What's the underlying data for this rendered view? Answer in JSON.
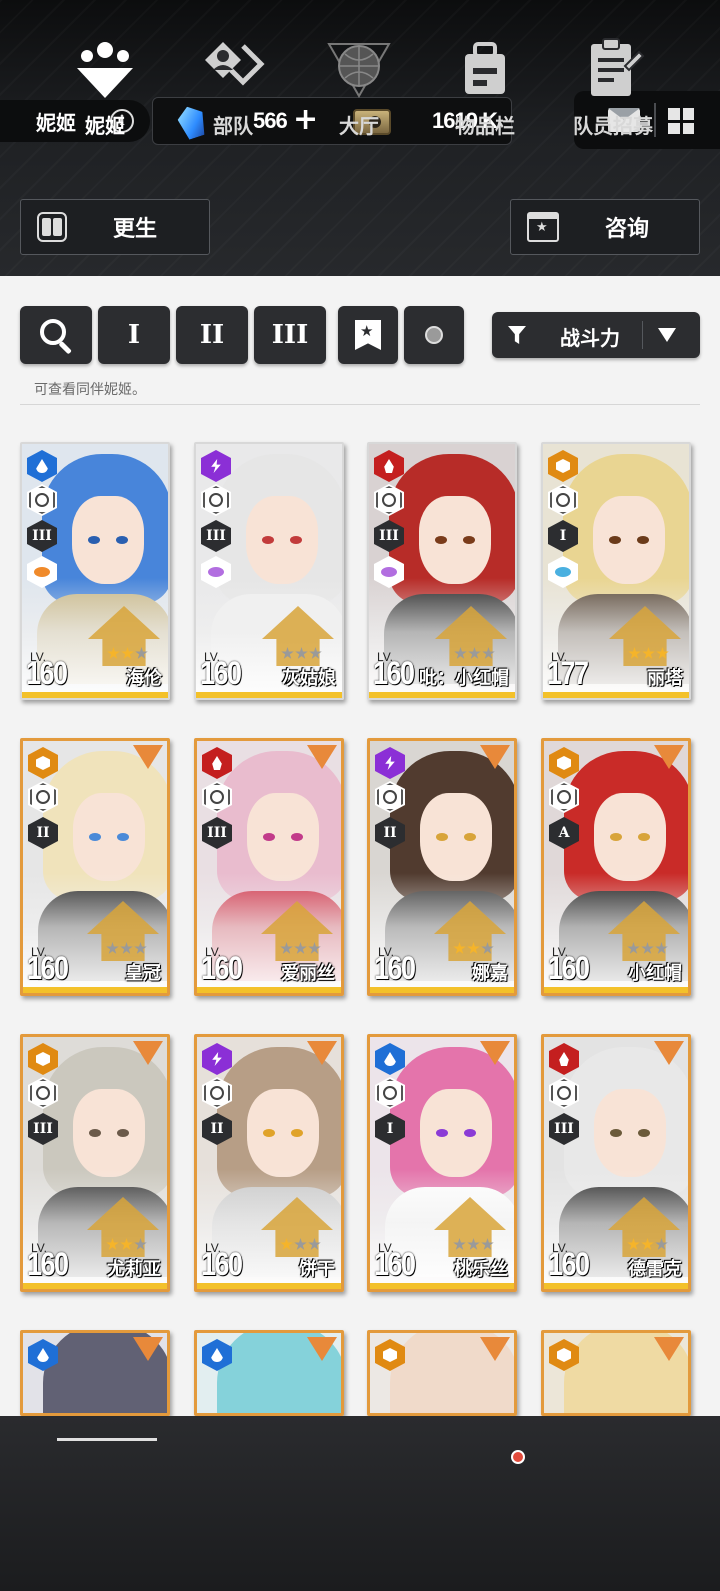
{
  "header": {
    "nikke_label": "妮姬",
    "gems": "566",
    "gem_plus": "+",
    "credits": "1619 K",
    "rebirth_label": "更生",
    "consult_label": "咨询"
  },
  "filters": {
    "burst_1": "I",
    "burst_2": "II",
    "burst_3": "III",
    "sort_label": "战斗力",
    "hint": "可查看同伴妮姬。"
  },
  "cards": [
    {
      "name": "海伦",
      "level": "160",
      "element": "water",
      "burst": "III",
      "stars": 2
    },
    {
      "name": "灰姑娘",
      "level": "160",
      "element": "electric",
      "burst": "III",
      "stars": 0
    },
    {
      "name": "吡：小红帽",
      "level": "160",
      "element": "fire",
      "burst": "III",
      "stars": 0
    },
    {
      "name": "丽塔",
      "level": "177",
      "element": "iron",
      "burst": "I",
      "stars": 3
    },
    {
      "name": "皇冠",
      "level": "160",
      "element": "iron",
      "burst": "II",
      "stars": 0
    },
    {
      "name": "爱丽丝",
      "level": "160",
      "element": "fire",
      "burst": "III",
      "stars": 0
    },
    {
      "name": "娜嘉",
      "level": "160",
      "element": "electric",
      "burst": "II",
      "stars": 2
    },
    {
      "name": "小红帽",
      "level": "160",
      "element": "iron",
      "burst": "A",
      "stars": 0
    },
    {
      "name": "尤莉亚",
      "level": "160",
      "element": "iron",
      "burst": "III",
      "stars": 2
    },
    {
      "name": "饼干",
      "level": "160",
      "element": "electric",
      "burst": "II",
      "stars": 1
    },
    {
      "name": "桃乐丝",
      "level": "160",
      "element": "water",
      "burst": "I",
      "stars": 0
    },
    {
      "name": "德雷克",
      "level": "160",
      "element": "fire",
      "burst": "III",
      "stars": 2
    }
  ],
  "lv_label": "LV.",
  "nav": {
    "nikke": "妮姬",
    "squad": "部队",
    "lobby": "大厅",
    "inventory": "物品栏",
    "recruit": "队员招募"
  },
  "colors": {
    "water": "#1f6fd6",
    "electric": "#8b2fd6",
    "fire": "#c41f1f",
    "iron": "#e08a12",
    "ssr_border": "#e39a3c",
    "level_bar": "#f3c12a"
  }
}
